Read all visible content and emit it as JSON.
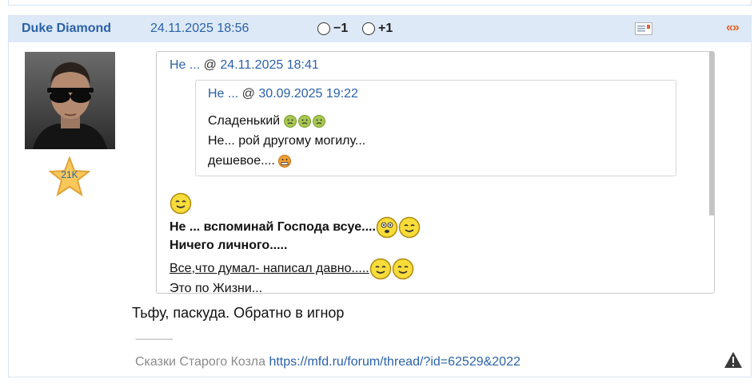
{
  "post": {
    "author": "Duke Diamond",
    "datetime": "24.11.2025 18:56",
    "vote_minus": "−1",
    "vote_plus": "+1",
    "quote_arrows": "«»",
    "rating": "21K",
    "accent_color": "#2a62a8",
    "header_bg": "#dde9f7"
  },
  "quote_outer": {
    "author": "Не ...",
    "sep": " @ ",
    "datetime": "24.11.2025 18:41",
    "lines": [
      "Не ... вспоминай Господа всуе....",
      "Ничего личного.....",
      "Все,что думал- написал давно.....",
      "Это по Жизни..."
    ]
  },
  "quote_inner": {
    "author": "Не ...",
    "sep": " @ ",
    "datetime": "30.09.2025 19:22",
    "lines": [
      "Сладенький",
      "Не... рой другому могилу...",
      "дешевое...."
    ]
  },
  "reply_text": "Тьфу, паскуда. Обратно в игнор",
  "signature": {
    "separator": "--------------------",
    "text": "Сказки Старого Козла ",
    "link": "https://mfd.ru/forum/thread/?id=62529&2022"
  }
}
